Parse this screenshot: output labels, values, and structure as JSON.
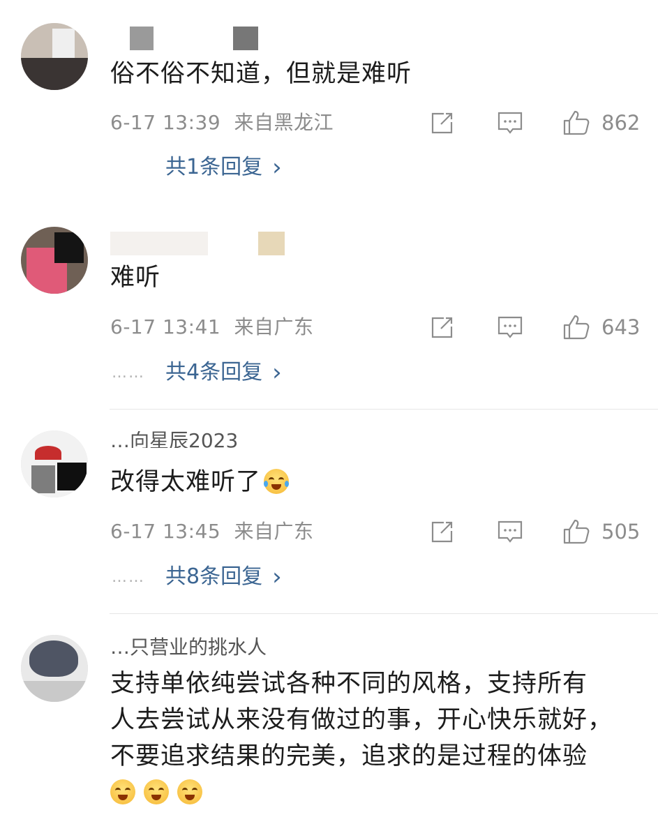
{
  "comments": [
    {
      "username": "",
      "text": "俗不俗不知道，但就是难听",
      "timestamp": "6-17 13:39",
      "location": "来自黑龙江",
      "likes": "862",
      "replies_label": "共1条回复",
      "icons": {
        "share": "share-icon",
        "comment": "comment-icon",
        "like": "thumbs-up-icon"
      }
    },
    {
      "username": "",
      "text": "难听",
      "timestamp": "6-17 13:41",
      "location": "来自广东",
      "likes": "643",
      "replies_preview": "……",
      "replies_label": "共4条回复"
    },
    {
      "username": "…向星辰2023",
      "text": "改得太难听了",
      "emoji": "crying-laughing-emoji",
      "timestamp": "6-17 13:45",
      "location": "来自广东",
      "likes": "505",
      "replies_preview": "……",
      "replies_label": "共8条回复"
    },
    {
      "username": "…只营业的挑水人",
      "text_lines": [
        "支持单依纯尝试各种不同的风格，支持所有",
        "人去尝试从来没有做过的事，开心快乐就好，",
        "不要追求结果的完美，追求的是过程的体验"
      ],
      "emojis": [
        "heart-eyes-emoji",
        "heart-eyes-emoji",
        "heart-eyes-emoji"
      ]
    }
  ],
  "chevron": "›",
  "colors": {
    "reply_link": "#3b6592",
    "meta": "#8c8c8c",
    "divider": "#e6e6e6"
  }
}
